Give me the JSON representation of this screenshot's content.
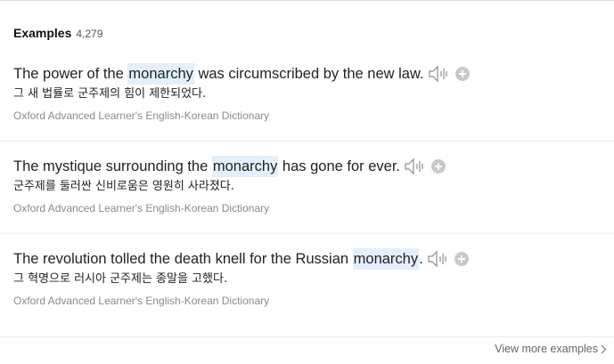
{
  "header": {
    "title": "Examples",
    "count": "4,279"
  },
  "examples": [
    {
      "pre": "The power of the ",
      "keyword": "monarchy",
      "post": " was circumscribed by the new law.",
      "translation": "그 새 법률로 군주제의 힘이 제한되었다.",
      "source": "Oxford Advanced Learner's English-Korean Dictionary"
    },
    {
      "pre": "The mystique surrounding the ",
      "keyword": "monarchy",
      "post": " has gone for ever.",
      "translation": "군주제를 둘러싼 신비로움은 영원히 사라졌다.",
      "source": "Oxford Advanced Learner's English-Korean Dictionary"
    },
    {
      "pre": "The revolution tolled the death knell for the Russian ",
      "keyword": "monarchy",
      "post": ".",
      "translation": "그 혁명으로 러시아 군주제는 종말을 고했다.",
      "source": "Oxford Advanced Learner's English-Korean Dictionary"
    }
  ],
  "icons": {
    "speaker": "speaker-icon",
    "add": "plus-circle-icon",
    "chevron": "chevron-right-icon"
  },
  "footer": {
    "view_more": "View more examples"
  },
  "colors": {
    "highlight": "#e3f0fb",
    "icon_gray": "#c9c9c9",
    "source_text": "#8a8a8a"
  }
}
